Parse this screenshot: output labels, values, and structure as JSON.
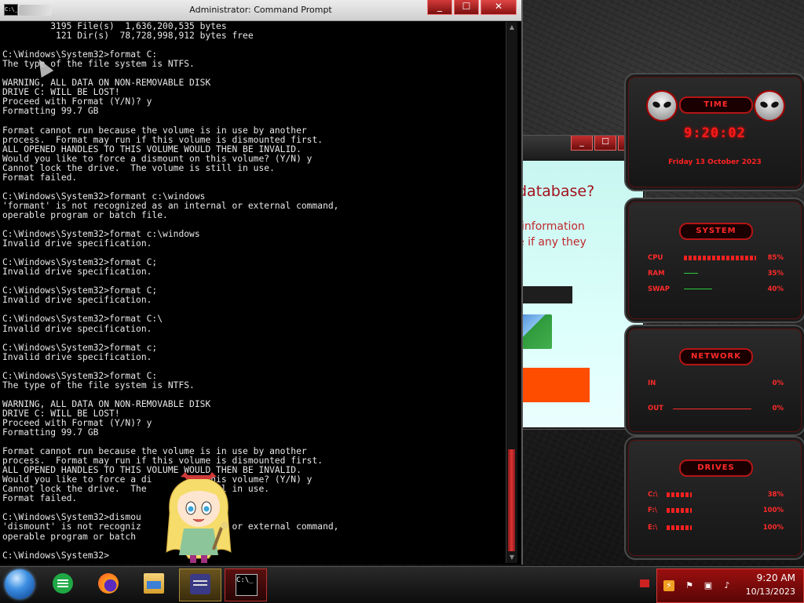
{
  "window": {
    "title": "Administrator: Command Prompt",
    "icon_text": "C:\\_",
    "controls": {
      "minimize": "_",
      "maximize": "☐",
      "close": "✕"
    }
  },
  "console": {
    "lines": [
      "         3195 File(s)  1,636,200,535 bytes",
      "          121 Dir(s)  78,728,998,912 bytes free",
      "",
      "C:\\Windows\\System32>format C:",
      "The type of the file system is NTFS.",
      "",
      "WARNING, ALL DATA ON NON-REMOVABLE DISK",
      "DRIVE C: WILL BE LOST!",
      "Proceed with Format (Y/N)? y",
      "Formatting 99.7 GB",
      "",
      "Format cannot run because the volume is in use by another",
      "process.  Format may run if this volume is dismounted first.",
      "ALL OPENED HANDLES TO THIS VOLUME WOULD THEN BE INVALID.",
      "Would you like to force a dismount on this volume? (Y/N) y",
      "Cannot lock the drive.  The volume is still in use.",
      "Format failed.",
      "",
      "C:\\Windows\\System32>formant c:\\windows",
      "'formant' is not recognized as an internal or external command,",
      "operable program or batch file.",
      "",
      "C:\\Windows\\System32>format c:\\windows",
      "Invalid drive specification.",
      "",
      "C:\\Windows\\System32>format C;",
      "Invalid drive specification.",
      "",
      "C:\\Windows\\System32>format C;",
      "Invalid drive specification.",
      "",
      "C:\\Windows\\System32>format C:\\",
      "Invalid drive specification.",
      "",
      "C:\\Windows\\System32>format c;",
      "Invalid drive specification.",
      "",
      "C:\\Windows\\System32>format C:",
      "The type of the file system is NTFS.",
      "",
      "WARNING, ALL DATA ON NON-REMOVABLE DISK",
      "DRIVE C: WILL BE LOST!",
      "Proceed with Format (Y/N)? y",
      "Formatting 99.7 GB",
      "",
      "Format cannot run because the volume is in use by another",
      "process.  Format may run if this volume is dismounted first.",
      "ALL OPENED HANDLES TO THIS VOLUME WOULD THEN BE INVALID.",
      "Would you like to force a di          this volume? (Y/N) y",
      "Cannot lock the drive.  The          still in use.",
      "Format failed.",
      "",
      "C:\\Windows\\System32>dismou",
      "'dismount' is not recogniz         nternal or external command,",
      "operable program or batch",
      "",
      "C:\\Windows\\System32>"
    ]
  },
  "background_window": {
    "controls": {
      "minimize": "_",
      "maximize": "☐",
      "close": "✕"
    },
    "heading": "database?",
    "line1": "information",
    "line2": "e if any they"
  },
  "gadgets": {
    "time": {
      "header": "TIME",
      "clock": "9:20:02",
      "date": "Friday 13 October 2023"
    },
    "system": {
      "header": "SYSTEM",
      "rows": [
        {
          "label": "CPU",
          "value": "85%"
        },
        {
          "label": "RAM",
          "value": "35%"
        },
        {
          "label": "SWAP",
          "value": "40%"
        }
      ]
    },
    "network": {
      "header": "NETWORK",
      "rows": [
        {
          "label": "IN",
          "value": "0%"
        },
        {
          "label": "OUT",
          "value": "0%"
        }
      ]
    },
    "drives": {
      "header": "DRIVES",
      "rows": [
        {
          "label": "C:\\",
          "value": "38%"
        },
        {
          "label": "F:\\",
          "value": "100%"
        },
        {
          "label": "E:\\",
          "value": "100%"
        }
      ]
    }
  },
  "taskbar": {
    "apps": [
      {
        "name": "start",
        "icon": "windows-orb-icon"
      },
      {
        "name": "notes",
        "icon": "green-notes-icon"
      },
      {
        "name": "firefox",
        "icon": "firefox-icon"
      },
      {
        "name": "file-explorer",
        "icon": "folder-icon"
      },
      {
        "name": "app-card",
        "icon": "card-icon"
      },
      {
        "name": "command-prompt",
        "icon": "cmd-icon",
        "label": "C:\\_"
      }
    ],
    "clock": {
      "time": "9:20 AM",
      "date": "10/13/2023"
    }
  },
  "colors": {
    "accent_red": "#ff1a1a",
    "console_bg": "#000000",
    "console_fg": "#e8e8e8",
    "bg_window_heading": "#a1121b",
    "bg_window_button": "#ff4d00"
  }
}
